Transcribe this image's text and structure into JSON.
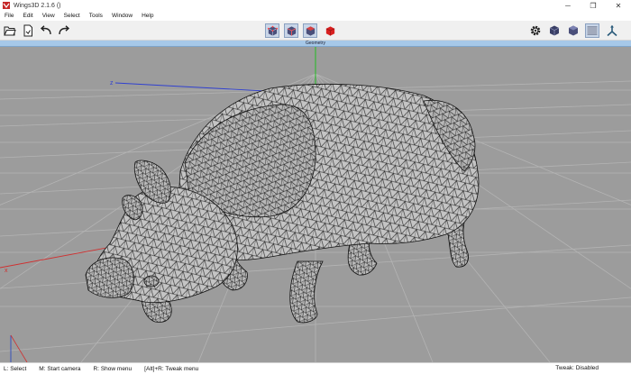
{
  "window": {
    "title": "Wings3D 2.1.6 ()",
    "minimize_glyph": "─",
    "restore_glyph": "❐",
    "close_glyph": "✕"
  },
  "menu": {
    "items": [
      "File",
      "Edit",
      "View",
      "Select",
      "Tools",
      "Window",
      "Help"
    ]
  },
  "toolbar": {
    "left_icons": [
      "open-folder-icon",
      "save-file-icon",
      "undo-icon",
      "redo-icon"
    ],
    "mode_icons": [
      "vertex-select-icon",
      "edge-select-icon",
      "face-select-icon",
      "body-select-icon"
    ],
    "right_icons": [
      "gear-icon",
      "smooth-cube-icon",
      "shaded-cube-icon",
      "wireframe-icon",
      "axes-icon"
    ]
  },
  "viewport": {
    "header": "Geometry",
    "axis_labels": {
      "z": "z",
      "x": "x"
    }
  },
  "statusbar": {
    "left": [
      "L: Select",
      "M: Start camera",
      "R: Show menu",
      "[Alt]+R: Tweak menu"
    ],
    "right": "Tweak: Disabled"
  },
  "colors": {
    "viewport_bg": "#9c9c9c",
    "grid": "#b4b4b4",
    "mesh_fill": "#c4c4c4",
    "mesh_wire": "#1a1a1a",
    "header_bg": "#a6c8e8",
    "select_accent": "#c9d6e8",
    "body_mode_red": "#d82020"
  }
}
